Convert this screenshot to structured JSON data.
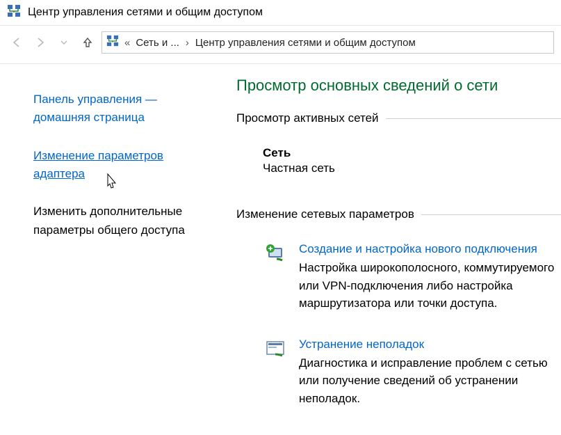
{
  "titlebar": {
    "title": "Центр управления сетями и общим доступом"
  },
  "address": {
    "seg1": "Сеть и ...",
    "seg2": "Центр управления сетями и общим доступом"
  },
  "sidebar": {
    "home": "Панель управления — домашняя страница",
    "adapter": "Изменение параметров адаптера",
    "sharing": "Изменить дополнительные параметры общего доступа"
  },
  "main": {
    "heading": "Просмотр основных сведений о сети",
    "active_label": "Просмотр активных сетей",
    "network_name": "Сеть",
    "network_type": "Частная сеть",
    "change_label": "Изменение сетевых параметров",
    "item1_title": "Создание и настройка нового подключения",
    "item1_desc": "Настройка широкополосного, коммутируемого или VPN-подключения либо настройка маршрутизатора или точки доступа.",
    "item2_title": "Устранение неполадок",
    "item2_desc": "Диагностика и исправление проблем с сетью или получение сведений об устранении неполадок."
  }
}
